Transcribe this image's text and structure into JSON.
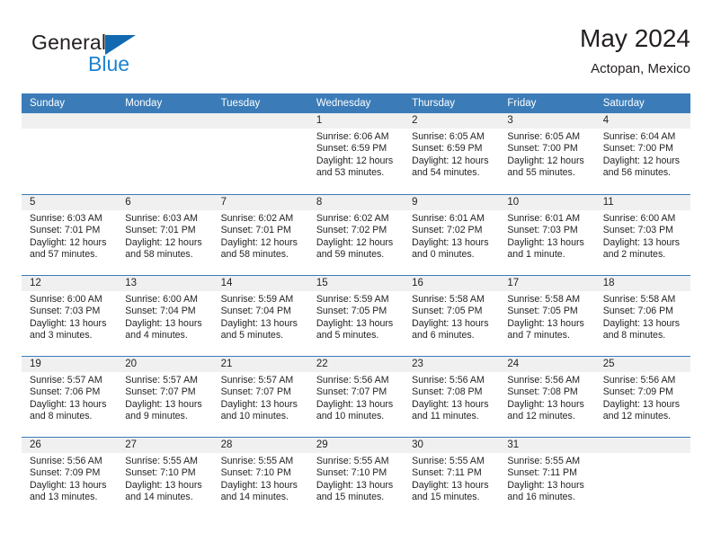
{
  "brand": {
    "name_dark": "General",
    "name_blue": "Blue",
    "accent_blue": "#1f83d0",
    "triangle_blue": "#1269b0"
  },
  "header": {
    "title": "May 2024",
    "subtitle": "Actopan, Mexico",
    "header_bar_color": "#3b7cb8",
    "day_band_color": "#f0f0f0"
  },
  "weekdays": [
    "Sunday",
    "Monday",
    "Tuesday",
    "Wednesday",
    "Thursday",
    "Friday",
    "Saturday"
  ],
  "weeks": [
    [
      {
        "day": "",
        "lines": []
      },
      {
        "day": "",
        "lines": []
      },
      {
        "day": "",
        "lines": []
      },
      {
        "day": "1",
        "lines": [
          "Sunrise: 6:06 AM",
          "Sunset: 6:59 PM",
          "Daylight: 12 hours",
          "and 53 minutes."
        ]
      },
      {
        "day": "2",
        "lines": [
          "Sunrise: 6:05 AM",
          "Sunset: 6:59 PM",
          "Daylight: 12 hours",
          "and 54 minutes."
        ]
      },
      {
        "day": "3",
        "lines": [
          "Sunrise: 6:05 AM",
          "Sunset: 7:00 PM",
          "Daylight: 12 hours",
          "and 55 minutes."
        ]
      },
      {
        "day": "4",
        "lines": [
          "Sunrise: 6:04 AM",
          "Sunset: 7:00 PM",
          "Daylight: 12 hours",
          "and 56 minutes."
        ]
      }
    ],
    [
      {
        "day": "5",
        "lines": [
          "Sunrise: 6:03 AM",
          "Sunset: 7:01 PM",
          "Daylight: 12 hours",
          "and 57 minutes."
        ]
      },
      {
        "day": "6",
        "lines": [
          "Sunrise: 6:03 AM",
          "Sunset: 7:01 PM",
          "Daylight: 12 hours",
          "and 58 minutes."
        ]
      },
      {
        "day": "7",
        "lines": [
          "Sunrise: 6:02 AM",
          "Sunset: 7:01 PM",
          "Daylight: 12 hours",
          "and 58 minutes."
        ]
      },
      {
        "day": "8",
        "lines": [
          "Sunrise: 6:02 AM",
          "Sunset: 7:02 PM",
          "Daylight: 12 hours",
          "and 59 minutes."
        ]
      },
      {
        "day": "9",
        "lines": [
          "Sunrise: 6:01 AM",
          "Sunset: 7:02 PM",
          "Daylight: 13 hours",
          "and 0 minutes."
        ]
      },
      {
        "day": "10",
        "lines": [
          "Sunrise: 6:01 AM",
          "Sunset: 7:03 PM",
          "Daylight: 13 hours",
          "and 1 minute."
        ]
      },
      {
        "day": "11",
        "lines": [
          "Sunrise: 6:00 AM",
          "Sunset: 7:03 PM",
          "Daylight: 13 hours",
          "and 2 minutes."
        ]
      }
    ],
    [
      {
        "day": "12",
        "lines": [
          "Sunrise: 6:00 AM",
          "Sunset: 7:03 PM",
          "Daylight: 13 hours",
          "and 3 minutes."
        ]
      },
      {
        "day": "13",
        "lines": [
          "Sunrise: 6:00 AM",
          "Sunset: 7:04 PM",
          "Daylight: 13 hours",
          "and 4 minutes."
        ]
      },
      {
        "day": "14",
        "lines": [
          "Sunrise: 5:59 AM",
          "Sunset: 7:04 PM",
          "Daylight: 13 hours",
          "and 5 minutes."
        ]
      },
      {
        "day": "15",
        "lines": [
          "Sunrise: 5:59 AM",
          "Sunset: 7:05 PM",
          "Daylight: 13 hours",
          "and 5 minutes."
        ]
      },
      {
        "day": "16",
        "lines": [
          "Sunrise: 5:58 AM",
          "Sunset: 7:05 PM",
          "Daylight: 13 hours",
          "and 6 minutes."
        ]
      },
      {
        "day": "17",
        "lines": [
          "Sunrise: 5:58 AM",
          "Sunset: 7:05 PM",
          "Daylight: 13 hours",
          "and 7 minutes."
        ]
      },
      {
        "day": "18",
        "lines": [
          "Sunrise: 5:58 AM",
          "Sunset: 7:06 PM",
          "Daylight: 13 hours",
          "and 8 minutes."
        ]
      }
    ],
    [
      {
        "day": "19",
        "lines": [
          "Sunrise: 5:57 AM",
          "Sunset: 7:06 PM",
          "Daylight: 13 hours",
          "and 8 minutes."
        ]
      },
      {
        "day": "20",
        "lines": [
          "Sunrise: 5:57 AM",
          "Sunset: 7:07 PM",
          "Daylight: 13 hours",
          "and 9 minutes."
        ]
      },
      {
        "day": "21",
        "lines": [
          "Sunrise: 5:57 AM",
          "Sunset: 7:07 PM",
          "Daylight: 13 hours",
          "and 10 minutes."
        ]
      },
      {
        "day": "22",
        "lines": [
          "Sunrise: 5:56 AM",
          "Sunset: 7:07 PM",
          "Daylight: 13 hours",
          "and 10 minutes."
        ]
      },
      {
        "day": "23",
        "lines": [
          "Sunrise: 5:56 AM",
          "Sunset: 7:08 PM",
          "Daylight: 13 hours",
          "and 11 minutes."
        ]
      },
      {
        "day": "24",
        "lines": [
          "Sunrise: 5:56 AM",
          "Sunset: 7:08 PM",
          "Daylight: 13 hours",
          "and 12 minutes."
        ]
      },
      {
        "day": "25",
        "lines": [
          "Sunrise: 5:56 AM",
          "Sunset: 7:09 PM",
          "Daylight: 13 hours",
          "and 12 minutes."
        ]
      }
    ],
    [
      {
        "day": "26",
        "lines": [
          "Sunrise: 5:56 AM",
          "Sunset: 7:09 PM",
          "Daylight: 13 hours",
          "and 13 minutes."
        ]
      },
      {
        "day": "27",
        "lines": [
          "Sunrise: 5:55 AM",
          "Sunset: 7:10 PM",
          "Daylight: 13 hours",
          "and 14 minutes."
        ]
      },
      {
        "day": "28",
        "lines": [
          "Sunrise: 5:55 AM",
          "Sunset: 7:10 PM",
          "Daylight: 13 hours",
          "and 14 minutes."
        ]
      },
      {
        "day": "29",
        "lines": [
          "Sunrise: 5:55 AM",
          "Sunset: 7:10 PM",
          "Daylight: 13 hours",
          "and 15 minutes."
        ]
      },
      {
        "day": "30",
        "lines": [
          "Sunrise: 5:55 AM",
          "Sunset: 7:11 PM",
          "Daylight: 13 hours",
          "and 15 minutes."
        ]
      },
      {
        "day": "31",
        "lines": [
          "Sunrise: 5:55 AM",
          "Sunset: 7:11 PM",
          "Daylight: 13 hours",
          "and 16 minutes."
        ]
      },
      {
        "day": "",
        "lines": []
      }
    ]
  ]
}
